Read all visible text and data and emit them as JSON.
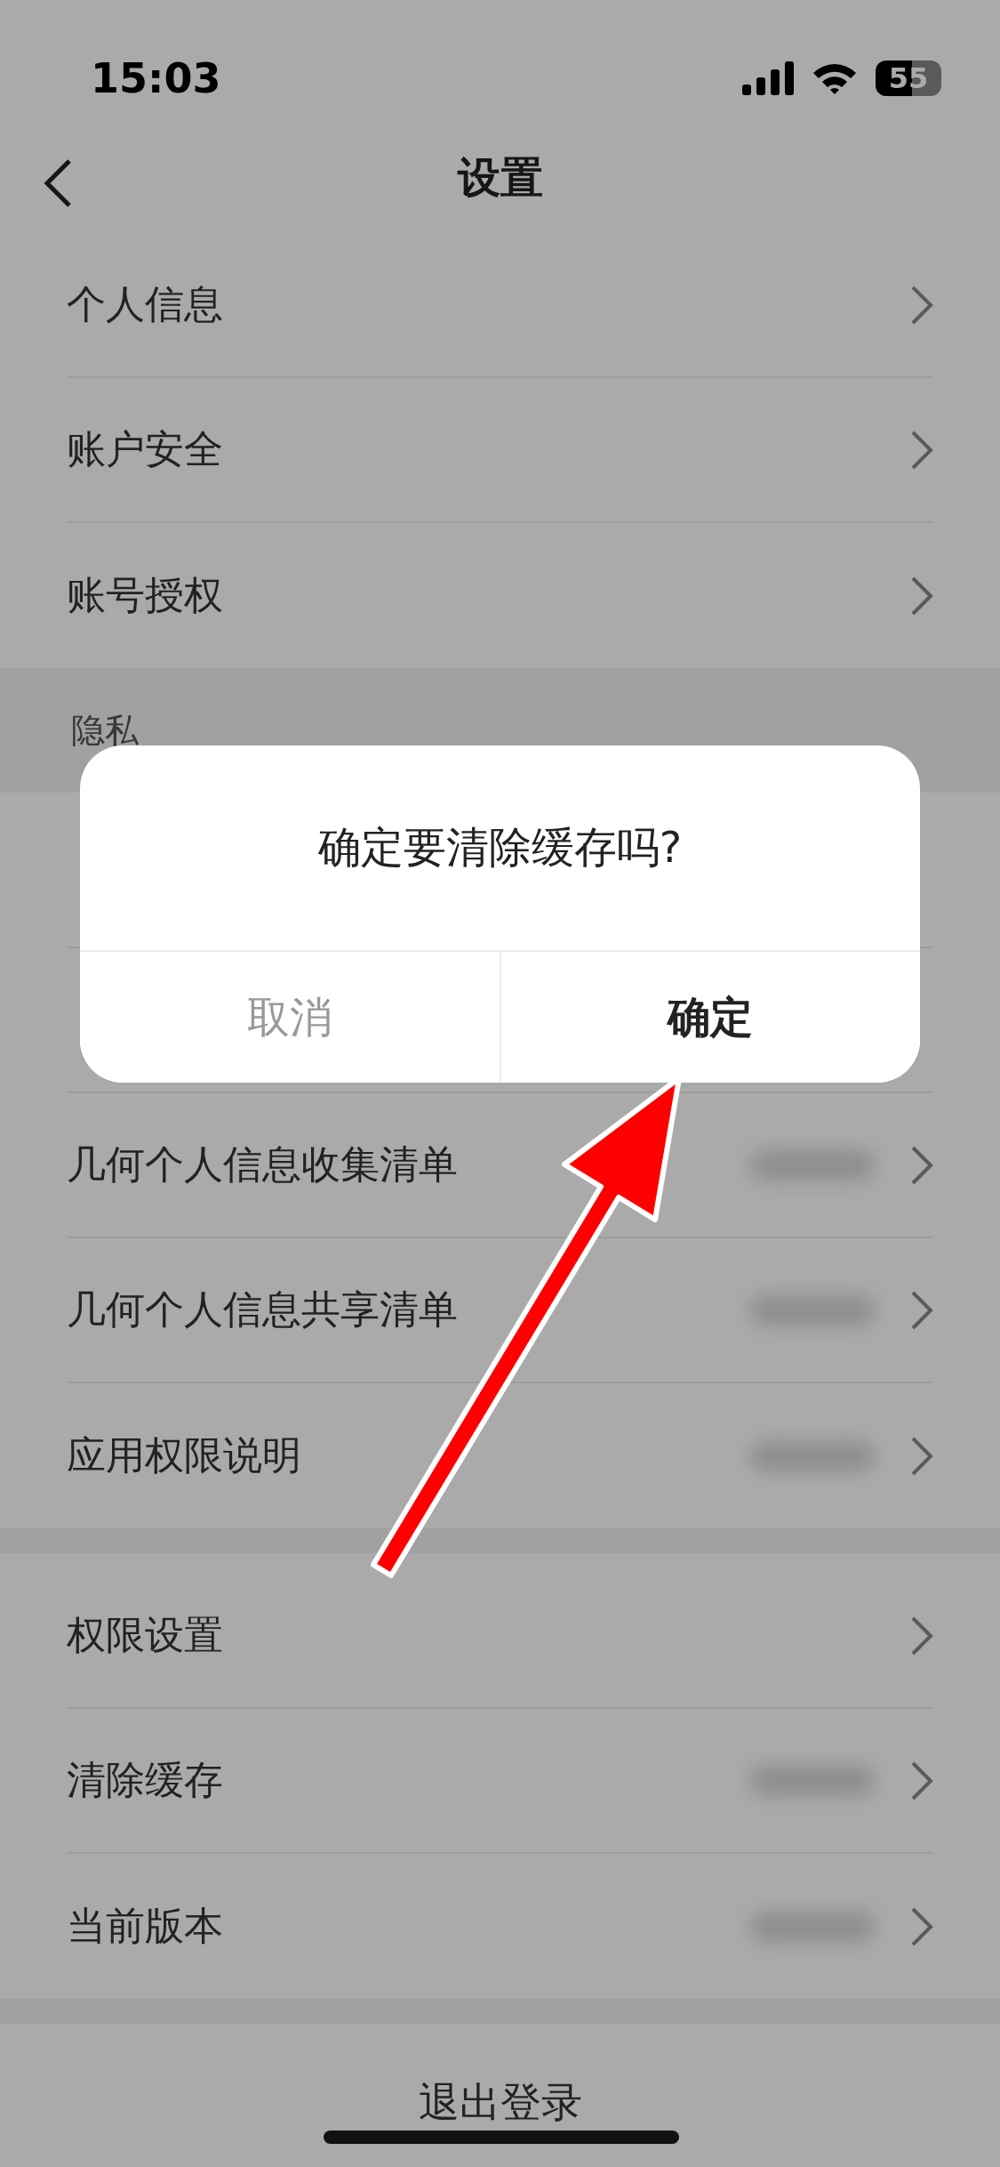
{
  "status_bar": {
    "time": "15:03",
    "battery": "55"
  },
  "nav": {
    "title": "设置"
  },
  "groups": [
    {
      "rows": [
        {
          "kind": "link",
          "label": "个人信息",
          "value_blurred": false
        },
        {
          "kind": "link",
          "label": "账户安全",
          "value_blurred": false
        },
        {
          "kind": "link",
          "label": "账号授权",
          "value_blurred": false
        }
      ]
    },
    {
      "header": "隐私",
      "rows": [
        {
          "kind": "covered"
        },
        {
          "kind": "covered"
        },
        {
          "kind": "link",
          "label": "几何个人信息收集清单",
          "value_blurred": true
        },
        {
          "kind": "link",
          "label": "几何个人信息共享清单",
          "value_blurred": true
        },
        {
          "kind": "link",
          "label": "应用权限说明",
          "value_blurred": true
        }
      ]
    },
    {
      "rows": [
        {
          "kind": "link",
          "label": "权限设置",
          "value_blurred": false
        },
        {
          "kind": "link",
          "label": "清除缓存",
          "value_blurred": true
        },
        {
          "kind": "link",
          "label": "当前版本",
          "value_blurred": true
        }
      ]
    }
  ],
  "logout": "退出登录",
  "dialog": {
    "message": "确定要清除缓存吗?",
    "buttons": [
      {
        "label": "取消",
        "primary": false
      },
      {
        "label": "确定",
        "primary": true
      }
    ]
  }
}
